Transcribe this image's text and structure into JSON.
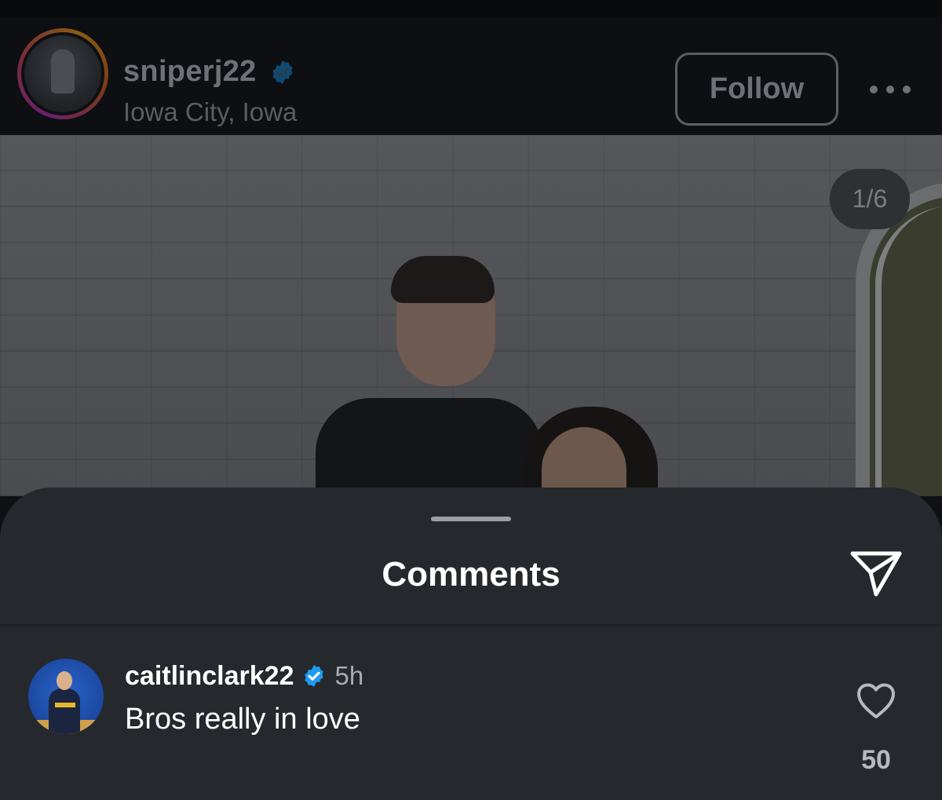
{
  "post": {
    "username": "sniperj22",
    "location": "Iowa City, Iowa",
    "follow_label": "Follow",
    "verified": true,
    "carousel_counter": "1/6"
  },
  "comments_sheet": {
    "title": "Comments",
    "comments": [
      {
        "username": "caitlinclark22",
        "verified": true,
        "time": "5h",
        "text": "Bros really in love",
        "like_count": "50"
      }
    ]
  },
  "icons": {
    "verified": "verified-badge-icon",
    "more": "more-options-icon",
    "share": "paper-plane-icon",
    "like": "heart-outline-icon"
  },
  "colors": {
    "verified_blue": "#1d9bf0",
    "sheet_background": "#25282d"
  }
}
